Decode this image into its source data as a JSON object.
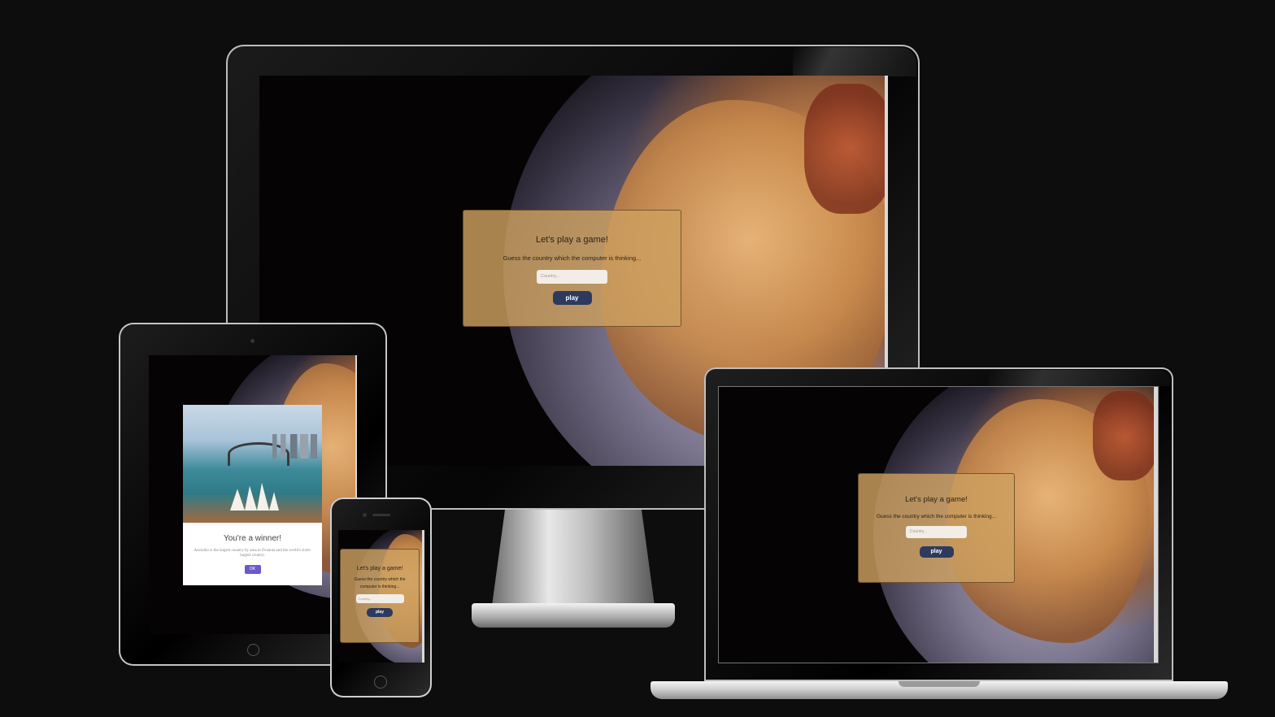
{
  "desktop": {
    "title": "Let's play a game!",
    "subtitle": "Guess the country which the computer is thinking...",
    "placeholder": "Country...",
    "button": "play"
  },
  "laptop": {
    "title": "Let's play a game!",
    "subtitle": "Guess the country which the computer is thinking...",
    "placeholder": "Country...",
    "button": "play"
  },
  "tablet": {
    "title": "You're a winner!",
    "body": "Australia is the largest country by area in Oceania and the world's sixth-largest country.",
    "button": "OK"
  },
  "phone": {
    "title": "Let's play a game!",
    "subtitle": "Guess the country which the computer is thinking...",
    "placeholder": "Country...",
    "button": "play"
  },
  "colors": {
    "background": "#0d0d0e",
    "panel": "#cda05f",
    "play_button": "#2d3a5e",
    "ok_button": "#6a5acd"
  }
}
